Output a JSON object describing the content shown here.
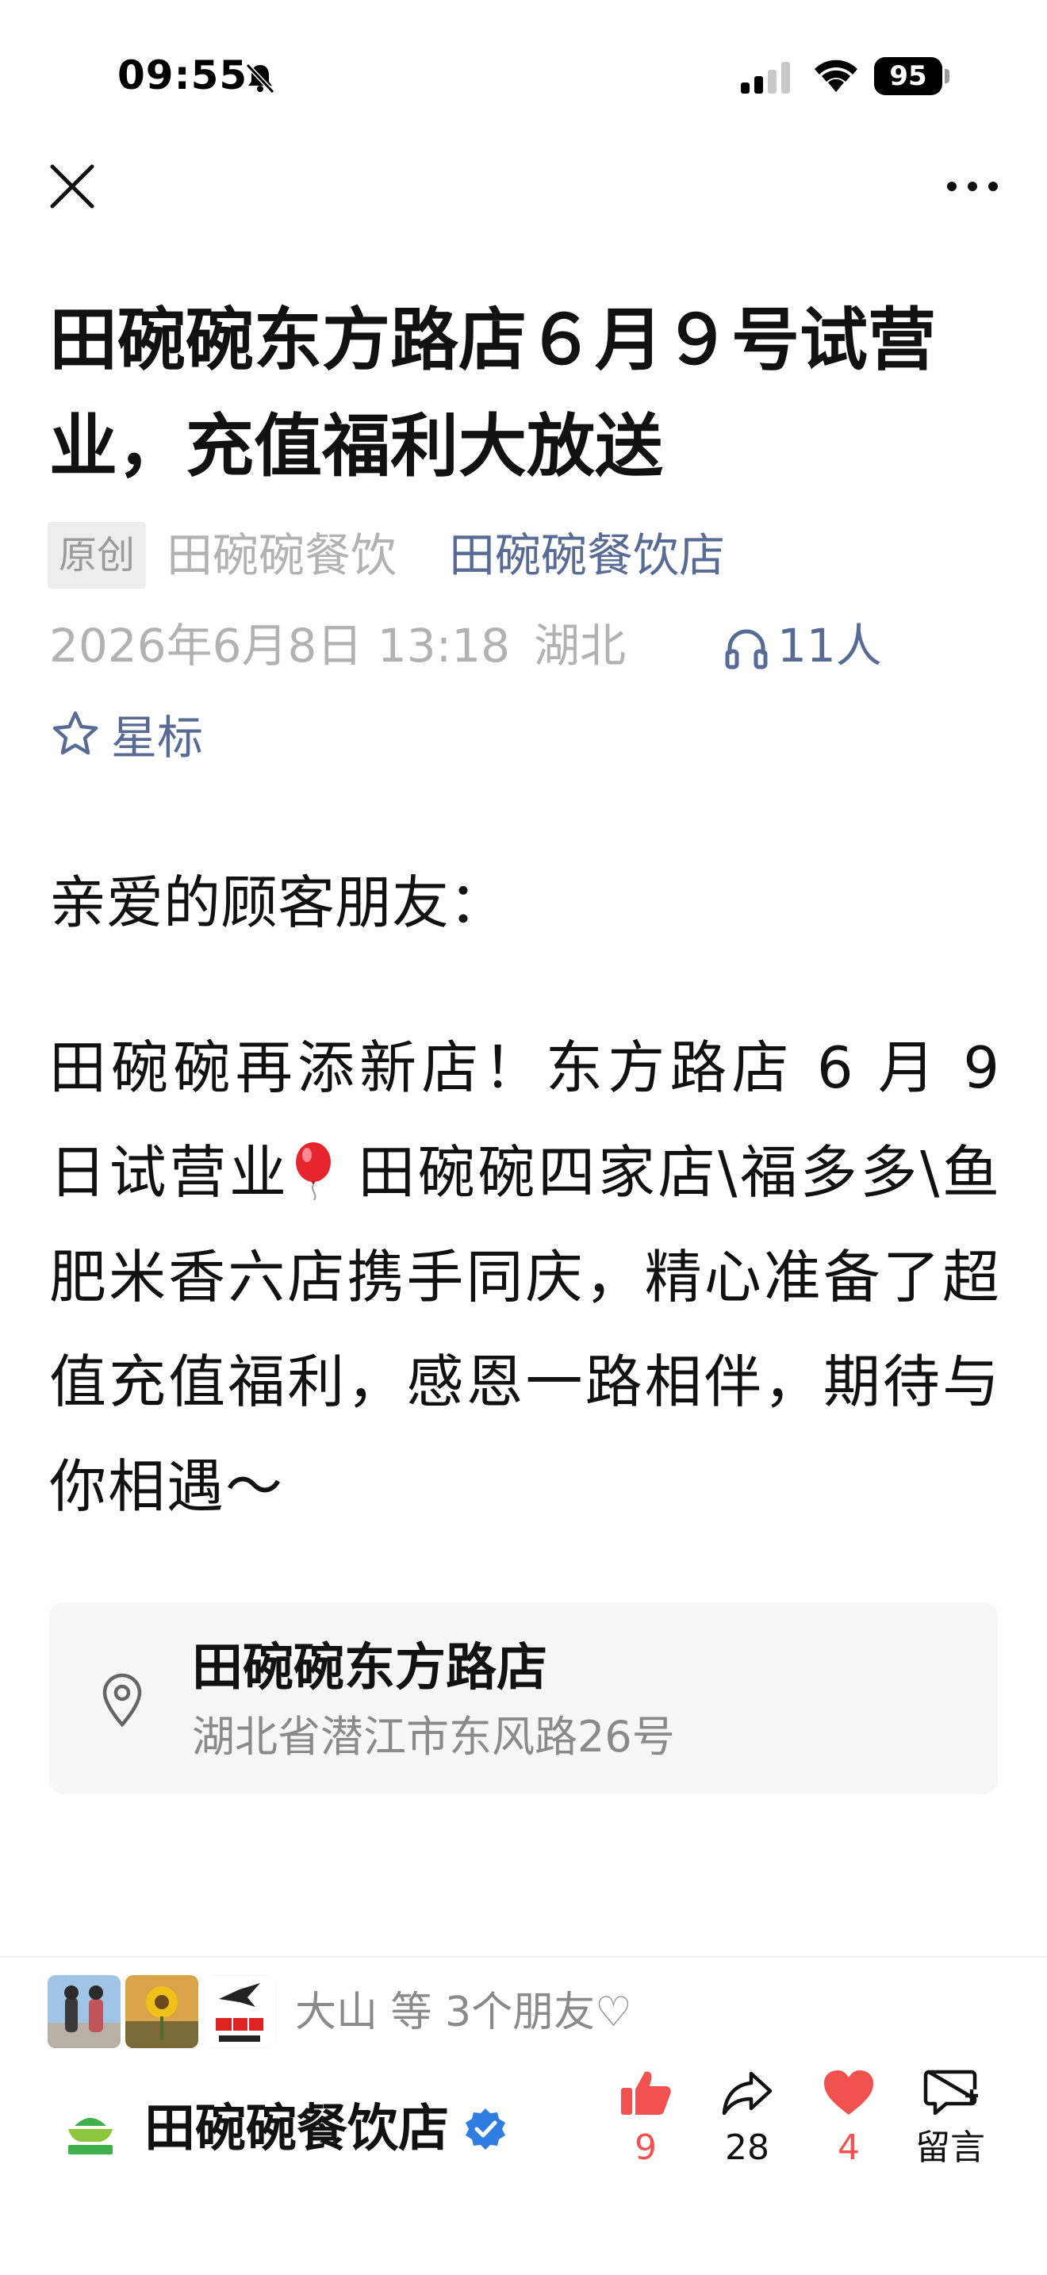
{
  "status_bar": {
    "time": "09:55",
    "battery": "95"
  },
  "article": {
    "title": "田碗碗东方路店６月９号试营业，充值福利大放送",
    "original_badge": "原创",
    "author": "田碗碗餐饮",
    "account_name": "田碗碗餐饮店",
    "date": "2026年6月8日 13:18",
    "location": "湖北",
    "listen_count": "11人",
    "star_label": "星标",
    "greeting": "亲爱的顾客朋友：",
    "paragraph_part1": "田碗碗再添新店！东方路店 6 月 9 日试营业",
    "paragraph_part2": " 田碗碗四家店\\福多多\\鱼肥米香六店携手同庆，精心准备了超值充值福利，感恩一路相伴，期待与你相遇～"
  },
  "location_card": {
    "name": "田碗碗东方路店",
    "address": "湖北省潜江市东风路26号"
  },
  "footer": {
    "friends_text": "大山 等 3个朋友♡",
    "account_name": "田碗碗餐饮店",
    "logo_text": "田碗碗",
    "actions": {
      "like_count": "9",
      "share_count": "28",
      "heart_count": "4",
      "comment_label": "留言"
    }
  },
  "colors": {
    "link": "#576b95",
    "meta": "#b2b2b2",
    "accent_red": "#f2524f",
    "verified_blue": "#2f7de1"
  }
}
